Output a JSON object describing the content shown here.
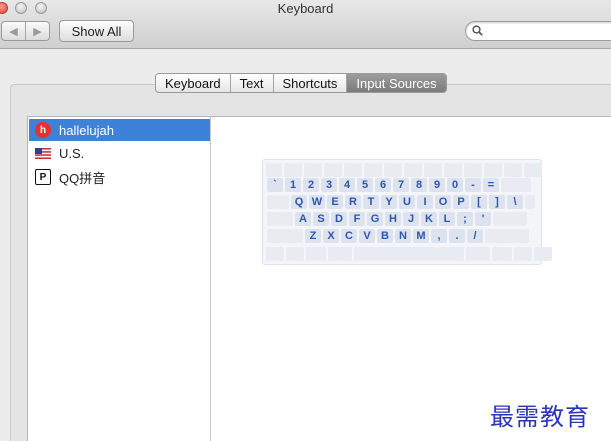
{
  "window": {
    "title": "Keyboard"
  },
  "toolbar": {
    "back_glyph": "◀",
    "forward_glyph": "▶",
    "show_all_label": "Show All",
    "search": {
      "value": "",
      "placeholder": ""
    }
  },
  "tabs": [
    {
      "label": "Keyboard",
      "active": false
    },
    {
      "label": "Text",
      "active": false
    },
    {
      "label": "Shortcuts",
      "active": false
    },
    {
      "label": "Input Sources",
      "active": true
    }
  ],
  "input_sources": [
    {
      "label": "hallelujah",
      "icon": "h-badge-icon",
      "icon_text": "h",
      "selected": true
    },
    {
      "label": "U.S.",
      "icon": "us-flag-icon",
      "selected": false
    },
    {
      "label": "QQ拼音",
      "icon": "p-badge-icon",
      "icon_text": "P",
      "selected": false
    }
  ],
  "keyboard_rows": [
    [
      "`",
      "1",
      "2",
      "3",
      "4",
      "5",
      "6",
      "7",
      "8",
      "9",
      "0",
      "-",
      "="
    ],
    [
      "Q",
      "W",
      "E",
      "R",
      "T",
      "Y",
      "U",
      "I",
      "O",
      "P",
      "[",
      "]",
      "\\"
    ],
    [
      "A",
      "S",
      "D",
      "F",
      "G",
      "H",
      "J",
      "K",
      "L",
      ";",
      "'"
    ],
    [
      "Z",
      "X",
      "C",
      "V",
      "B",
      "N",
      "M",
      ",",
      ".",
      "/"
    ]
  ],
  "watermark": "最需教育",
  "colors": {
    "selection": "#3d82d8",
    "key_text": "#2f56a8",
    "watermark": "#2a34b8"
  }
}
